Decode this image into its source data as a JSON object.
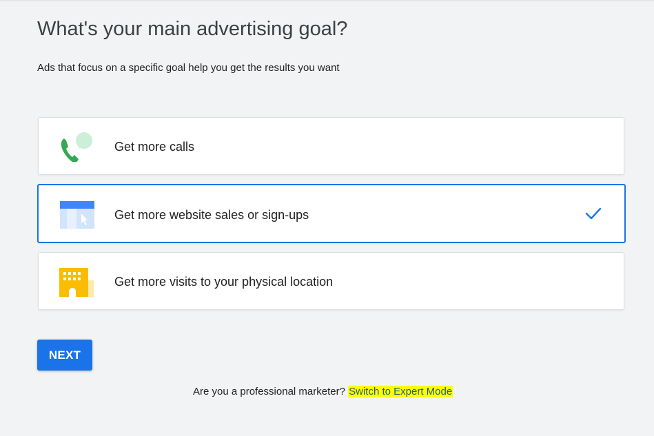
{
  "page": {
    "title": "What's your main advertising goal?",
    "subtitle": "Ads that focus on a specific goal help you get the results you want"
  },
  "options": [
    {
      "label": "Get more calls",
      "icon": "phone-call-icon",
      "selected": false
    },
    {
      "label": "Get more website sales or sign-ups",
      "icon": "website-cursor-icon",
      "selected": true
    },
    {
      "label": "Get more visits to your physical location",
      "icon": "storefront-building-icon",
      "selected": false
    }
  ],
  "actions": {
    "next_label": "NEXT"
  },
  "footer": {
    "question": "Are you a professional marketer?",
    "link_label": "Switch to Expert Mode"
  },
  "colors": {
    "primary_blue": "#1a73e8",
    "background": "#f1f3f4",
    "phone_green": "#34a853",
    "bubble_green": "#cdeed8",
    "building_yellow": "#fbbc04",
    "highlight_yellow": "#ffff00"
  }
}
